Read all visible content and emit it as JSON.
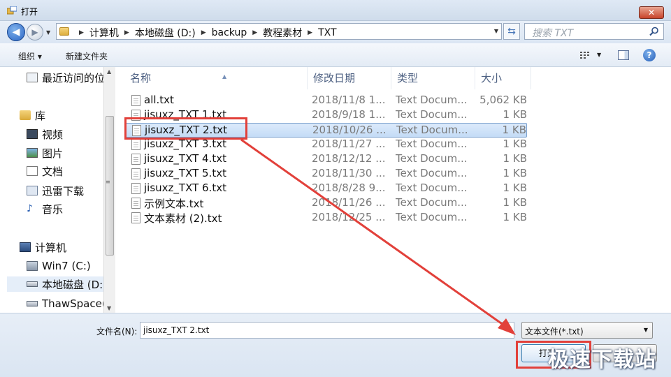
{
  "window": {
    "title": "打开",
    "close_label": "✕"
  },
  "address": {
    "crumbs": [
      "计算机",
      "本地磁盘 (D:)",
      "backup",
      "教程素材",
      "TXT"
    ],
    "search_placeholder": "搜索 TXT"
  },
  "toolbar": {
    "organize_label": "组织 ▾",
    "new_folder_label": "新建文件夹"
  },
  "nav": {
    "items": [
      {
        "label": "最近访问的位",
        "icon": "recent-places-icon"
      },
      {
        "label": "库",
        "icon": "libraries-icon"
      },
      {
        "label": "视频",
        "icon": "videos-icon"
      },
      {
        "label": "图片",
        "icon": "pictures-icon"
      },
      {
        "label": "文档",
        "icon": "documents-icon"
      },
      {
        "label": "迅雷下载",
        "icon": "download-folder-icon"
      },
      {
        "label": "音乐",
        "icon": "music-icon"
      },
      {
        "label": "计算机",
        "icon": "computer-icon"
      },
      {
        "label": "Win7 (C:)",
        "icon": "system-drive-icon"
      },
      {
        "label": "本地磁盘 (D:",
        "icon": "drive-icon"
      },
      {
        "label": "ThawSpace(",
        "icon": "drive-icon"
      }
    ]
  },
  "columns": {
    "name": "名称",
    "date": "修改日期",
    "type": "类型",
    "size": "大小"
  },
  "files": [
    {
      "name": "all.txt",
      "date": "2018/11/8 1...",
      "type": "Text Docum...",
      "size": "5,062 KB"
    },
    {
      "name": "jisuxz_TXT 1.txt",
      "date": "2018/9/18 1...",
      "type": "Text Docum...",
      "size": "1 KB"
    },
    {
      "name": "jisuxz_TXT 2.txt",
      "date": "2018/10/26 ...",
      "type": "Text Docum...",
      "size": "1 KB"
    },
    {
      "name": "jisuxz_TXT 3.txt",
      "date": "2018/11/27 ...",
      "type": "Text Docum...",
      "size": "1 KB"
    },
    {
      "name": "jisuxz_TXT 4.txt",
      "date": "2018/12/12 ...",
      "type": "Text Docum...",
      "size": "1 KB"
    },
    {
      "name": "jisuxz_TXT 5.txt",
      "date": "2018/11/30 ...",
      "type": "Text Docum...",
      "size": "1 KB"
    },
    {
      "name": "jisuxz_TXT 6.txt",
      "date": "2018/8/28 9...",
      "type": "Text Docum...",
      "size": "1 KB"
    },
    {
      "name": "示例文本.txt",
      "date": "2018/11/26 ...",
      "type": "Text Docum...",
      "size": "1 KB"
    },
    {
      "name": "文本素材 (2).txt",
      "date": "2018/12/25 ...",
      "type": "Text Docum...",
      "size": "1 KB"
    }
  ],
  "selected_file_index": 2,
  "bottom": {
    "filename_label": "文件名(N):",
    "filename_value": "jisuxz_TXT 2.txt",
    "filetype_value": "文本文件(*.txt)",
    "open_label": "打开",
    "cancel_label": ""
  },
  "watermark": "极速下载站",
  "colors": {
    "annotation": "#e2403a",
    "selection": "#cde1f7"
  }
}
